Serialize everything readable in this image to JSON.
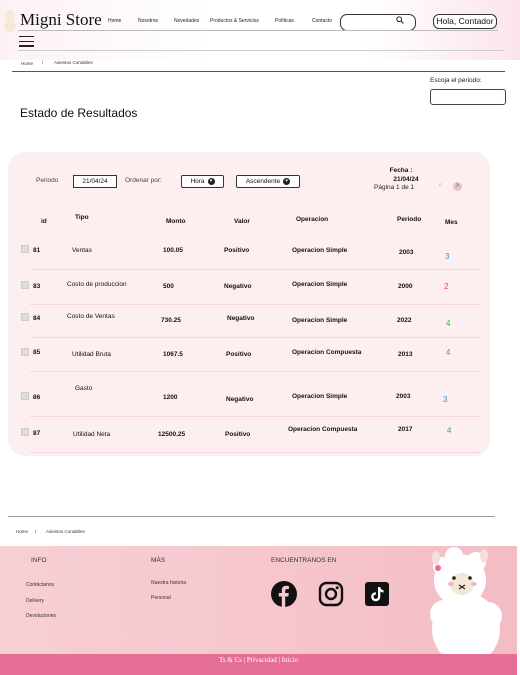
{
  "header": {
    "logo": "Migni Store",
    "nav": [
      "Home",
      "Nosotros",
      "Novedades",
      "Productos & Servicios",
      "Políticas",
      "Contacto"
    ],
    "search": {
      "placeholder": ""
    },
    "greeting": "Hola, Contador"
  },
  "breadcrumb": {
    "home": "Home",
    "sep": "/",
    "current": "Asientos Contables"
  },
  "period": {
    "label": "Escoja el periodo:",
    "value": ""
  },
  "page_title": "Estado de Resultados",
  "controls": {
    "periodo_label": "Periodo",
    "periodo_value": "21/04/24",
    "ordenar_label": "Ordenar por:",
    "order_field": "Hora",
    "order_dir": "Ascendente",
    "fecha_label": "Fecha :",
    "fecha_value": "21/04/24",
    "page_info": "Página 1 de 1",
    "prev": "<",
    "next": ">"
  },
  "table": {
    "headers": [
      "id",
      "Tipo",
      "Monto",
      "Valor",
      "Operacion",
      "Periodo",
      "Mes"
    ],
    "rows": [
      {
        "id": "81",
        "tipo": "Ventas",
        "monto": "100.05",
        "valor": "Positivo",
        "operacion": "Operacion Simple",
        "periodo": "2003",
        "mes": "3",
        "mes_color": "#3b8fd6"
      },
      {
        "id": "83",
        "tipo": "Costo de produccion",
        "monto": "500",
        "valor": "Negativo",
        "operacion": "Operacion Simple",
        "periodo": "2000",
        "mes": "2",
        "mes_color": "#e0463a"
      },
      {
        "id": "84",
        "tipo": "Costo de Ventas",
        "monto": "730.25",
        "valor": "Negativo",
        "operacion": "Operacion Simple",
        "periodo": "2022",
        "mes": "4",
        "mes_color": "#3ab53a"
      },
      {
        "id": "85",
        "tipo": "Utilidad Bruta",
        "monto": "1067.5",
        "valor": "Positivo",
        "operacion": "Operacion Compuesta",
        "periodo": "2013",
        "mes": "4",
        "mes_color": "#3ab53a"
      },
      {
        "id": "86",
        "tipo": "Gasto",
        "monto": "1200",
        "valor": "Negativo",
        "operacion": "Operacion Simple",
        "periodo": "2003",
        "mes": "3",
        "mes_color": "#3b8fd6"
      },
      {
        "id": "87",
        "tipo": "Utilidad Neta",
        "monto": "12500.25",
        "valor": "Positivo",
        "operacion": "Operacion Compuesta",
        "periodo": "2017",
        "mes": "4",
        "mes_color": "#3ab53a"
      }
    ]
  },
  "footer_breadcrumb": {
    "home": "Home",
    "sep": "/",
    "current": "Asientos Contables"
  },
  "footer": {
    "info_title": "INFO",
    "info_links": [
      "Contáctanos",
      "Delivery",
      "Devoluciones"
    ],
    "mas_title": "MÁS",
    "mas_links": [
      "Nuestra historia",
      "Personal"
    ],
    "social_title": "ENCUENTRANOS EN",
    "social_icons": [
      "facebook-icon",
      "instagram-icon",
      "tiktok-icon"
    ],
    "bottom": "Ts & Cs |  Privacidad  | Inicio"
  }
}
